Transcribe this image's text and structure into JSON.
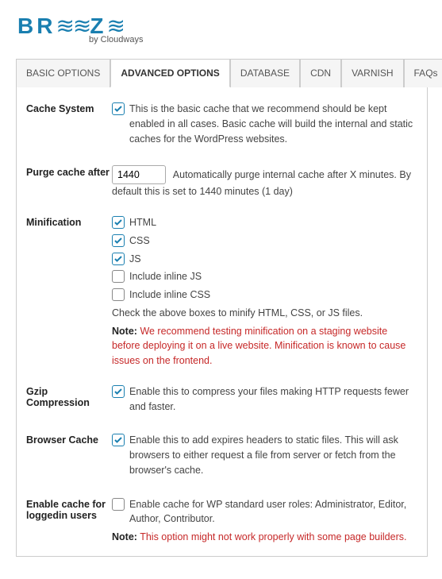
{
  "logo": {
    "text_before": "BR",
    "text_after": "Z",
    "tagline": "by Cloudways"
  },
  "tabs": [
    {
      "label": "BASIC OPTIONS",
      "active": false
    },
    {
      "label": "ADVANCED OPTIONS",
      "active": true
    },
    {
      "label": "DATABASE",
      "active": false
    },
    {
      "label": "CDN",
      "active": false
    },
    {
      "label": "VARNISH",
      "active": false
    },
    {
      "label": "FAQs",
      "active": false
    }
  ],
  "sections": {
    "cache_system": {
      "label": "Cache System",
      "text": "This is the basic cache that we recommend should be kept enabled in all cases. Basic cache will build the internal and static caches for the WordPress websites."
    },
    "purge": {
      "label": "Purge cache after",
      "value": "1440",
      "text": "Automatically purge internal cache after X minutes. By default this is set to 1440 minutes (1 day)"
    },
    "minification": {
      "label": "Minification",
      "options": {
        "html": "HTML",
        "css": "CSS",
        "js": "JS",
        "inline_js": "Include inline JS",
        "inline_css": "Include inline CSS"
      },
      "help": "Check the above boxes to minify HTML, CSS, or JS files.",
      "note_label": "Note:",
      "note": "We recommend testing minification on a staging website before deploying it on a live website. Minification is known to cause issues on the frontend."
    },
    "gzip": {
      "label": "Gzip Compression",
      "text": "Enable this to compress your files making HTTP requests fewer and faster."
    },
    "browser_cache": {
      "label": "Browser Cache",
      "text": "Enable this to add expires headers to static files. This will ask browsers to either request a file from server or fetch from the browser's cache."
    },
    "loggedin": {
      "label": "Enable cache for loggedin users",
      "text": "Enable cache for WP standard user roles: Administrator, Editor, Author, Contributor.",
      "note_label": "Note:",
      "note": "This option might not work properly with some page builders."
    }
  }
}
